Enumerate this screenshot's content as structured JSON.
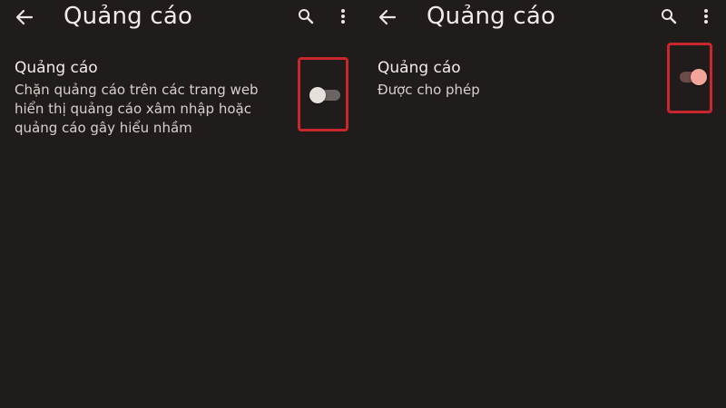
{
  "colors": {
    "background": "#201c1b",
    "text_primary": "#f1ebe8",
    "text_secondary": "#d8d0cc",
    "highlight_border": "#c9262d",
    "toggle_off_thumb": "#e7e1de",
    "toggle_on_thumb": "#f3a59c"
  },
  "left_panel": {
    "header": {
      "back_icon": "arrow-left-icon",
      "title": "Quảng cáo",
      "search_icon": "search-icon",
      "more_icon": "more-vertical-icon"
    },
    "setting": {
      "title": "Quảng cáo",
      "description": "Chặn quảng cáo trên các trang web hiển thị quảng cáo xâm nhập hoặc quảng cáo gây hiểu nhầm",
      "toggle_state": "off"
    }
  },
  "right_panel": {
    "header": {
      "back_icon": "arrow-left-icon",
      "title": "Quảng cáo",
      "search_icon": "search-icon",
      "more_icon": "more-vertical-icon"
    },
    "setting": {
      "title": "Quảng cáo",
      "description": "Được cho phép",
      "toggle_state": "on"
    }
  }
}
